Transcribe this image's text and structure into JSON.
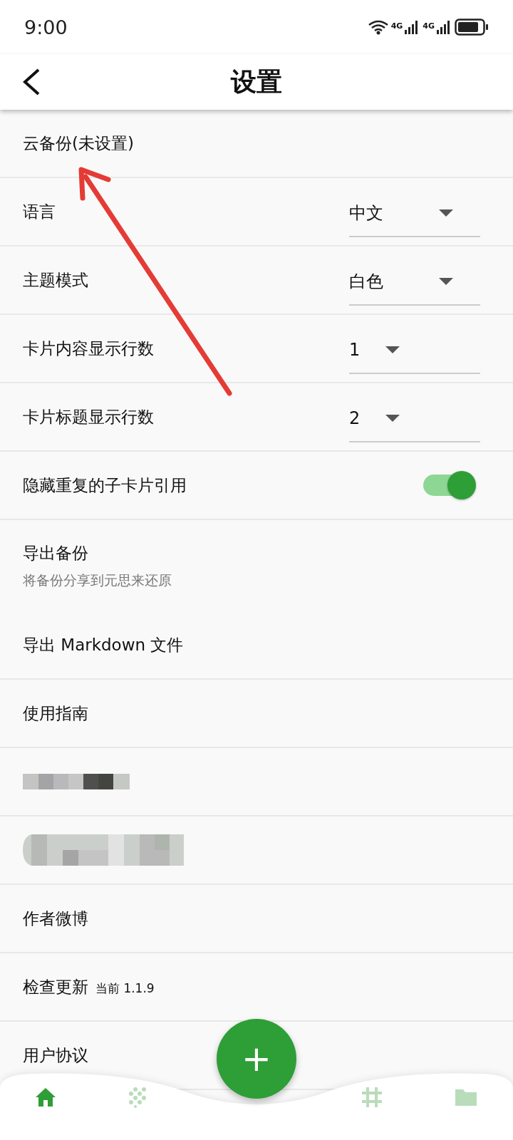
{
  "status_bar": {
    "time": "9:00",
    "sim_1": "4G",
    "sim_2": "4G"
  },
  "app_bar": {
    "title": "设置"
  },
  "settings": [
    {
      "kind": "plain",
      "label": "云备份(未设置)"
    },
    {
      "kind": "dropdown",
      "label": "语言",
      "value": "中文"
    },
    {
      "kind": "dropdown",
      "label": "主题模式",
      "value": "白色"
    },
    {
      "kind": "dropdown",
      "label": "卡片内容显示行数",
      "value": "1"
    },
    {
      "kind": "dropdown",
      "label": "卡片标题显示行数",
      "value": "2"
    },
    {
      "kind": "toggle",
      "label": "隐藏重复的子卡片引用",
      "on": true
    },
    {
      "kind": "subtitle",
      "label": "导出备份",
      "subtitle": "将备份分享到元思来还原"
    },
    {
      "kind": "plain",
      "label": "导出 Markdown 文件"
    },
    {
      "kind": "plain",
      "label": "使用指南"
    },
    {
      "kind": "redacted"
    },
    {
      "kind": "redacted"
    },
    {
      "kind": "plain",
      "label": "作者微博"
    },
    {
      "kind": "version",
      "label": "检查更新",
      "note": "当前 1.1.9"
    },
    {
      "kind": "plain",
      "label": "用户协议"
    }
  ],
  "fab": {
    "label": "+"
  },
  "bottom_nav": [
    {
      "kind": "home",
      "selected": true
    },
    {
      "kind": "dots",
      "selected": false
    },
    {
      "kind": "hash",
      "selected": false
    },
    {
      "kind": "folder",
      "selected": false
    }
  ]
}
